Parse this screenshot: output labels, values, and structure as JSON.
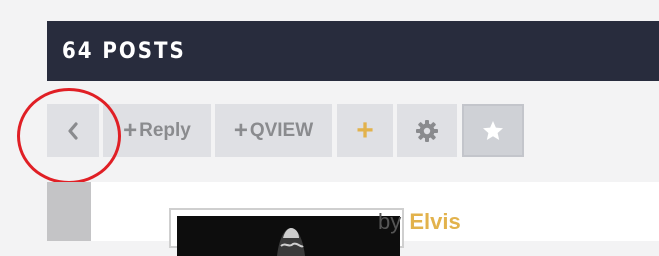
{
  "header": {
    "title": "64 POSTS"
  },
  "toolbar": {
    "reply_label": "Reply",
    "qview_label": "QVIEW"
  },
  "post": {
    "by_label": "by",
    "author": "Elvis"
  },
  "colors": {
    "header_bg": "#282c3d",
    "button_bg": "#dfe0e4",
    "accent_gold": "#e2b24c",
    "highlight_circle": "#e01f25"
  },
  "icons": {
    "back": "chevron-left-icon",
    "reply": "plus-icon",
    "qview": "plus-icon",
    "add": "plus-icon",
    "settings": "gear-icon",
    "favorite": "star-icon"
  }
}
